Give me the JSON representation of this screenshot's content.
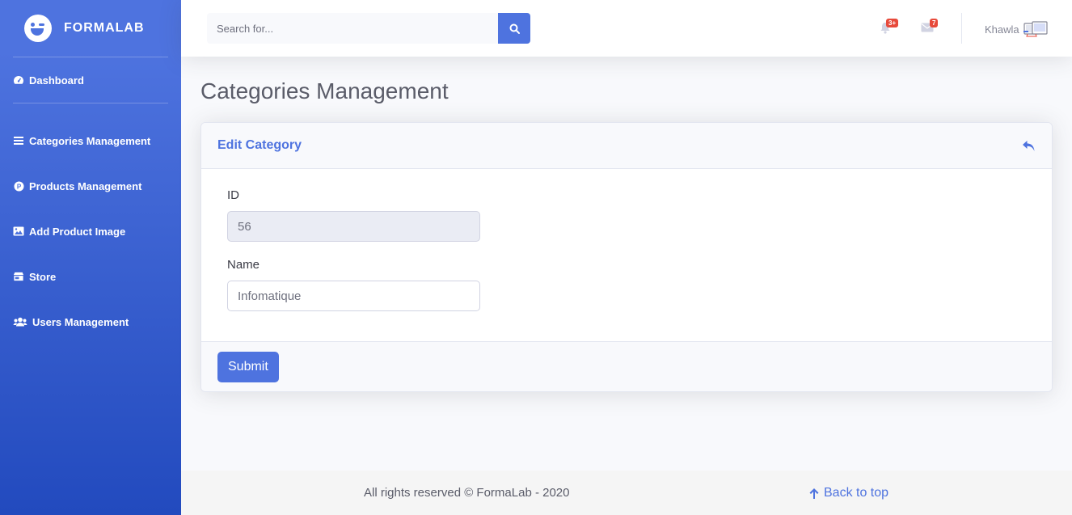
{
  "brand": {
    "name": "FORMALAB"
  },
  "sidebar": {
    "items": [
      {
        "label": "Dashboard",
        "icon": "tachometer-icon"
      },
      {
        "label": "Categories Management",
        "icon": "list-icon"
      },
      {
        "label": "Products Management",
        "icon": "product-p-icon"
      },
      {
        "label": "Add Product Image",
        "icon": "image-icon"
      },
      {
        "label": "Store",
        "icon": "store-icon"
      },
      {
        "label": "Users Management",
        "icon": "users-icon"
      }
    ]
  },
  "topbar": {
    "search_placeholder": "Search for...",
    "alerts_badge": "3+",
    "messages_badge": "7",
    "user_name": "Khawla"
  },
  "page": {
    "title": "Categories Management"
  },
  "card": {
    "title": "Edit Category",
    "fields": [
      {
        "label": "ID",
        "value": "56"
      },
      {
        "label": "Name",
        "value": "Infomatique"
      }
    ],
    "submit_label": "Submit"
  },
  "footer": {
    "copyright": "All rights reserved © FormaLab - 2020",
    "back_to_top": "Back to top"
  },
  "colors": {
    "primary": "#4e73df",
    "danger": "#e74a3b",
    "sidebar_dark": "#224abe"
  }
}
